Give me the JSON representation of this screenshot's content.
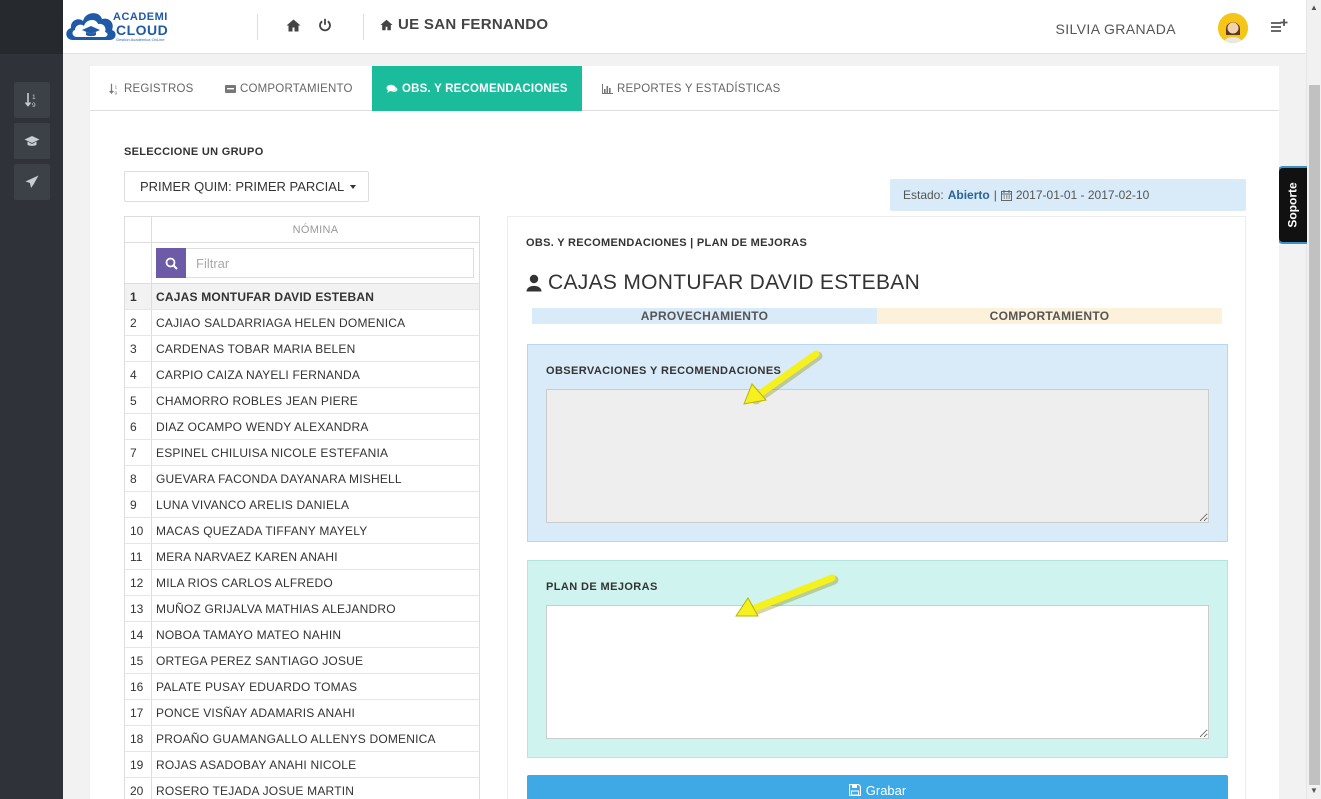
{
  "app": {
    "logo_line1": "ACADEMI",
    "logo_line2": "CLOUD",
    "logo_tagline": "Gestión Académica OnLine",
    "school_name": "UE SAN FERNANDO",
    "user_name": "SILVIA GRANADA",
    "support_tab": "Soporte"
  },
  "sidebar": {
    "items": [
      {
        "icon": "sort-icon"
      },
      {
        "icon": "graduation-cap-icon"
      },
      {
        "icon": "paper-plane-icon"
      }
    ]
  },
  "tabs": [
    {
      "label": "REGISTROS",
      "icon": "sort-icon",
      "active": false
    },
    {
      "label": "COMPORTAMIENTO",
      "icon": "card-icon",
      "active": false
    },
    {
      "label": "OBS. Y RECOMENDACIONES",
      "icon": "comments-icon",
      "active": true
    },
    {
      "label": "REPORTES Y ESTADÍSTICAS",
      "icon": "bar-chart-icon",
      "active": false
    }
  ],
  "group": {
    "label": "SELECCIONE UN GRUPO",
    "selected": "PRIMER QUIM: PRIMER PARCIAL"
  },
  "estado": {
    "prefix": "Estado:",
    "value": "Abierto",
    "separator": "|",
    "dates": "2017-01-01 - 2017-02-10"
  },
  "nomina": {
    "header": "NÓMINA",
    "filter_placeholder": "Filtrar",
    "students": [
      {
        "num": "1",
        "name": "CAJAS MONTUFAR DAVID ESTEBAN"
      },
      {
        "num": "2",
        "name": "CAJIAO SALDARRIAGA HELEN DOMENICA"
      },
      {
        "num": "3",
        "name": "CARDENAS TOBAR MARIA BELEN"
      },
      {
        "num": "4",
        "name": "CARPIO CAIZA NAYELI FERNANDA"
      },
      {
        "num": "5",
        "name": "CHAMORRO ROBLES JEAN PIERE"
      },
      {
        "num": "6",
        "name": "DIAZ OCAMPO WENDY ALEXANDRA"
      },
      {
        "num": "7",
        "name": "ESPINEL CHILUISA NICOLE ESTEFANIA"
      },
      {
        "num": "8",
        "name": "GUEVARA FACONDA DAYANARA MISHELL"
      },
      {
        "num": "9",
        "name": "LUNA VIVANCO ARELIS DANIELA"
      },
      {
        "num": "10",
        "name": "MACAS QUEZADA TIFFANY MAYELY"
      },
      {
        "num": "11",
        "name": "MERA NARVAEZ KAREN ANAHI"
      },
      {
        "num": "12",
        "name": "MILA RIOS CARLOS ALFREDO"
      },
      {
        "num": "13",
        "name": "MUÑOZ GRIJALVA MATHIAS ALEJANDRO"
      },
      {
        "num": "14",
        "name": "NOBOA TAMAYO MATEO NAHIN"
      },
      {
        "num": "15",
        "name": "ORTEGA PEREZ SANTIAGO JOSUE"
      },
      {
        "num": "16",
        "name": "PALATE PUSAY EDUARDO TOMAS"
      },
      {
        "num": "17",
        "name": "PONCE VISÑAY ADAMARIS ANAHI"
      },
      {
        "num": "18",
        "name": "PROAÑO GUAMANGALLO ALLENYS DOMENICA"
      },
      {
        "num": "19",
        "name": "ROJAS ASADOBAY ANAHI NICOLE"
      },
      {
        "num": "20",
        "name": "ROSERO TEJADA JOSUE MARTIN"
      }
    ]
  },
  "detail": {
    "title": "OBS. Y RECOMENDACIONES | PLAN DE MEJORAS",
    "student_name": "CAJAS MONTUFAR DAVID ESTEBAN",
    "band_aprovechamiento": "APROVECHAMIENTO",
    "band_comportamiento": "COMPORTAMIENTO",
    "obs_label": "OBSERVACIONES Y RECOMENDACIONES",
    "obs_value": "",
    "plan_label": "PLAN DE MEJORAS",
    "plan_value": "",
    "save_label": "Grabar"
  },
  "colors": {
    "accent_tab": "#1abc9c",
    "search_button": "#6d5ba8",
    "save_button": "#3fa9e6",
    "sidebar": "#2f3238",
    "annotation_arrow": "#f5f11e"
  }
}
